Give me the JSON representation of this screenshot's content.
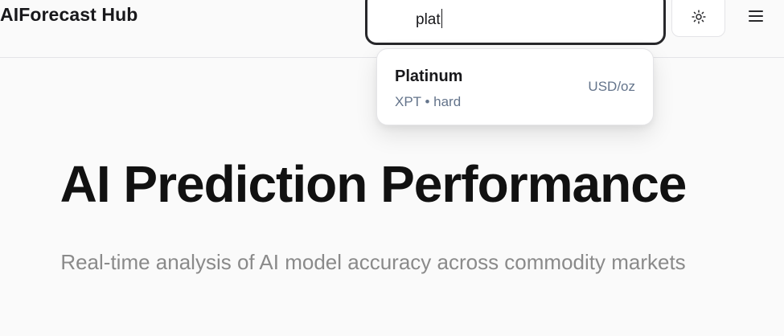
{
  "header": {
    "brand": "AIForecast Hub",
    "search": {
      "value": "plat"
    },
    "theme_toggle_icon": "sun-icon",
    "menu_icon": "hamburger-menu-icon"
  },
  "search_results": [
    {
      "name": "Platinum",
      "symbol": "XPT",
      "category": "hard",
      "meta": "XPT • hard",
      "unit": "USD/oz"
    }
  ],
  "hero": {
    "title": "AI Prediction Performance",
    "subtitle": "Real-time analysis of AI model accuracy across commodity markets"
  },
  "colors": {
    "background": "#fafafa",
    "text_primary": "#18181b",
    "text_muted": "#64748b",
    "subtitle": "#8a8a8a",
    "border": "#e4e4e7"
  }
}
